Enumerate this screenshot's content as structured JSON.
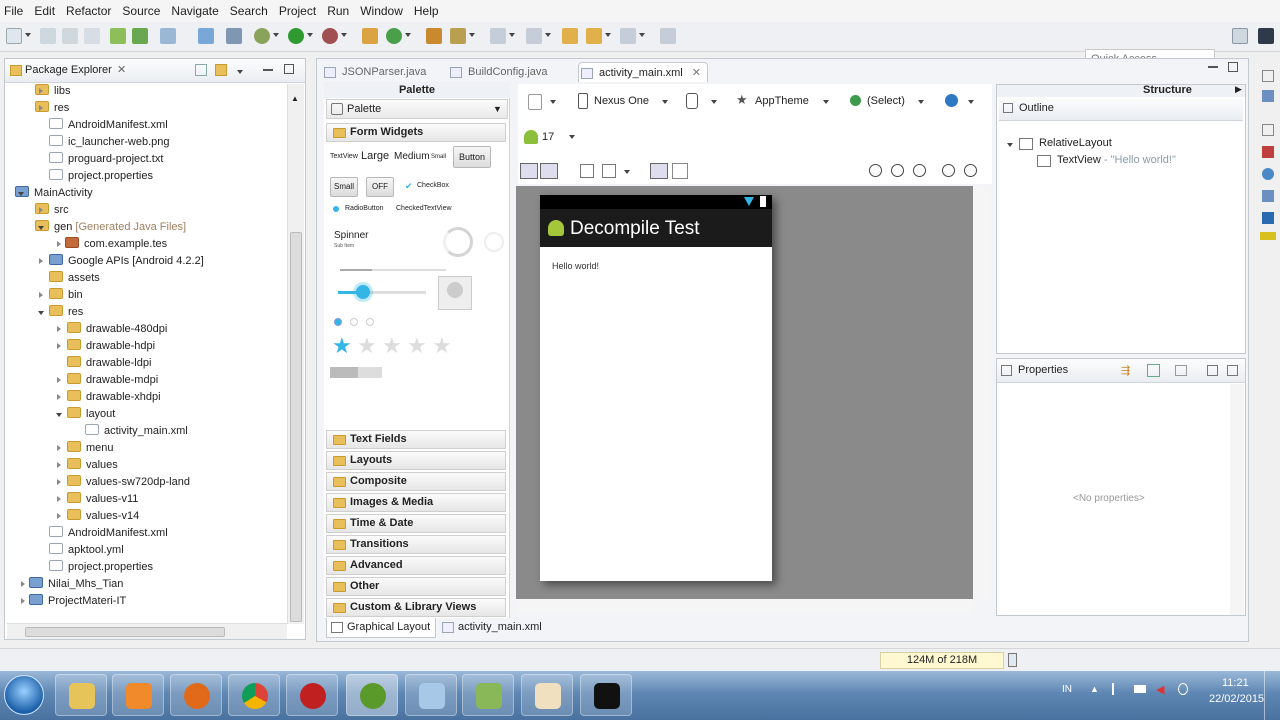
{
  "menu": [
    "File",
    "Edit",
    "Refactor",
    "Source",
    "Navigate",
    "Search",
    "Project",
    "Run",
    "Window",
    "Help"
  ],
  "quick_access": "Quick Access",
  "package_explorer": {
    "title": "Package Explorer",
    "items": [
      "libs",
      "res",
      "AndroidManifest.xml",
      "ic_launcher-web.png",
      "proguard-project.txt",
      "project.properties",
      "MainActivity",
      "src",
      "gen",
      "[Generated Java Files]",
      "com.example.tes",
      "Google APIs [Android 4.2.2]",
      "assets",
      "bin",
      "res",
      "drawable-480dpi",
      "drawable-hdpi",
      "drawable-ldpi",
      "drawable-mdpi",
      "drawable-xhdpi",
      "layout",
      "activity_main.xml",
      "menu",
      "values",
      "values-sw720dp-land",
      "values-v11",
      "values-v14",
      "AndroidManifest.xml",
      "apktool.yml",
      "project.properties",
      "Nilai_Mhs_Tian",
      "ProjectMateri-IT"
    ]
  },
  "editor_tabs": [
    "JSONParser.java",
    "BuildConfig.java",
    "activity_main.xml"
  ],
  "palette": {
    "header": "Palette",
    "title": "Palette",
    "section": "Form Widgets",
    "textview": "TextView",
    "large": "Large",
    "medium": "Medium",
    "small": "Small",
    "button": "Button",
    "btn_small": "Small",
    "btn_off": "OFF",
    "checkbox": "CheckBox",
    "radio": "RadioButton",
    "checked_textview": "CheckedTextView",
    "spinner": "Spinner",
    "spinner_sub": "Sub Item",
    "categories": [
      "Text Fields",
      "Layouts",
      "Composite",
      "Images & Media",
      "Time & Date",
      "Transitions",
      "Advanced",
      "Other",
      "Custom & Library Views"
    ]
  },
  "designer": {
    "device": "Nexus One",
    "theme": "AppTheme",
    "select": "(Select)",
    "api": "17",
    "app_title": "Decompile Test",
    "hello": "Hello world!"
  },
  "bottom_tabs": [
    "Graphical Layout",
    "activity_main.xml"
  ],
  "structure": {
    "header": "Structure",
    "outline": "Outline",
    "root": "RelativeLayout",
    "child": "TextView",
    "child_text": "- \"Hello world!\""
  },
  "properties": {
    "title": "Properties",
    "empty": "<No properties>"
  },
  "status": {
    "heap": "124M of 218M"
  },
  "clock": {
    "time": "11:21",
    "date": "22/02/2015",
    "lang": "IN"
  },
  "colors": {
    "accent": "#33b5e5",
    "appbar": "#1b1b1b"
  }
}
